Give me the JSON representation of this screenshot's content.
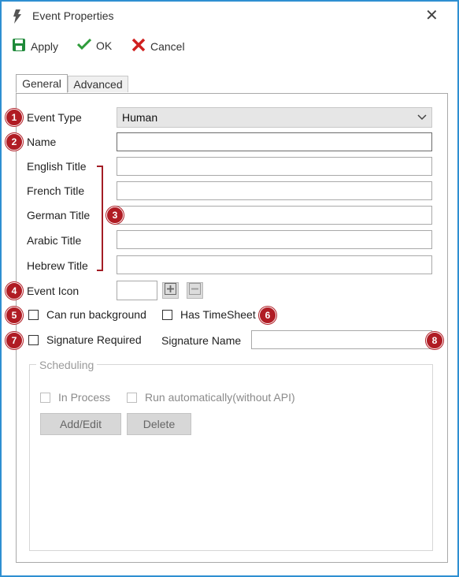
{
  "window": {
    "title": "Event Properties",
    "close_symbol": "✕"
  },
  "toolbar": {
    "apply_label": "Apply",
    "ok_label": "OK",
    "cancel_label": "Cancel"
  },
  "tabs": [
    {
      "label": "General",
      "active": true
    },
    {
      "label": "Advanced",
      "active": false
    }
  ],
  "form": {
    "event_type": {
      "label": "Event Type",
      "value": "Human"
    },
    "name": {
      "label": "Name",
      "value": ""
    },
    "titles": [
      {
        "label": "English Title",
        "value": ""
      },
      {
        "label": "French Title",
        "value": ""
      },
      {
        "label": "German Title",
        "value": ""
      },
      {
        "label": "Arabic Title",
        "value": ""
      },
      {
        "label": "Hebrew Title",
        "value": ""
      }
    ],
    "event_icon": {
      "label": "Event Icon"
    },
    "can_run_background": {
      "label": "Can run background",
      "checked": false
    },
    "has_timesheet": {
      "label": "Has TimeSheet",
      "checked": false
    },
    "signature_required": {
      "label": "Signature Required",
      "checked": false
    },
    "signature_name": {
      "label": "Signature Name",
      "value": ""
    }
  },
  "scheduling": {
    "title": "Scheduling",
    "in_process": {
      "label": "In Process",
      "checked": false
    },
    "run_automatically": {
      "label": "Run automatically(without API)",
      "checked": false
    },
    "add_edit_label": "Add/Edit",
    "delete_label": "Delete"
  },
  "badges": [
    "1",
    "2",
    "3",
    "4",
    "5",
    "6",
    "7",
    "8"
  ],
  "colors": {
    "accent_border": "#2e8fd1",
    "badge_red": "#b01c24",
    "ok_green": "#2e9b3a",
    "cancel_red": "#d0201f",
    "apply_green": "#1f8a3a"
  }
}
